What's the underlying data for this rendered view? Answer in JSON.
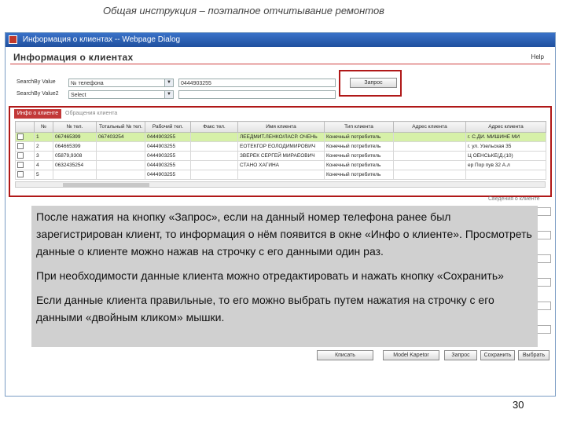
{
  "slide_title": "Общая инструкция – поэтапное отчитывание ремонтов",
  "window": {
    "title": "Информация о клиентах -- Webpage Dialog",
    "header": "Информация о клиентах",
    "help": "Help"
  },
  "search": {
    "row1_label": "SearchBy Value",
    "row1_select": "№ телефона",
    "row1_value": "0444903255",
    "row2_label": "SearchBy Value2",
    "row2_select": "Select",
    "query_button": "Запрос"
  },
  "tabs": [
    "Инфо о клиенте",
    "Обращения клиента"
  ],
  "grid": {
    "columns": [
      "",
      "№",
      "№ тел.",
      "Тотальный № тел.",
      "Рабочий тел.",
      "Факс тел.",
      "Имя клиента",
      "Тип клиента",
      "Адрес клиента",
      "Адрес клиента"
    ],
    "rows": [
      [
        "",
        "1",
        "067465399",
        "067403254",
        "0444903255",
        "",
        "ЛЕЕДМИТ.ЛЕНКО/ЛАСР. ОЧЕНЬ",
        "Конечный потребитель",
        "",
        "г. С.ДИ. МИШИНЕ МИ"
      ],
      [
        "",
        "2",
        "064665399",
        "",
        "0444903255",
        "",
        "ЕОТЕКГОР ЕОЛОДИМИРОВИЧ",
        "Конечный потребитель",
        "",
        "г. ул. Узельская 35"
      ],
      [
        "",
        "3",
        "05879,9308",
        "",
        "0444903255",
        "",
        "ЗВЕРЕК СЕРГЕЙ МИРАЕОВИЧ",
        "Конечный потребитель",
        "",
        "Ц ОЕНСЬКЕ(Д.(10)"
      ],
      [
        "",
        "4",
        "0632435254",
        "",
        "0444903255",
        "",
        "СТАНО ХАГИНА",
        "Конечный потребитель",
        "",
        "ер Пор пув 32 А.л"
      ],
      [
        "",
        "5",
        "",
        "",
        "0444903255",
        "",
        "",
        "Конечный потребитель",
        "",
        ""
      ]
    ]
  },
  "form_hint": "Сведения о клиенте",
  "overlay": {
    "p1": "После нажатия на кнопку «Запрос», если на данный номер телефона ранее был зарегистрирован клиент, то информация о нём появится в окне «Инфо о клиенте». Просмотреть данные о клиенте можно нажав на строчку с его данными один раз.",
    "p2": "При необходимости данные клиента можно отредактировать и нажать кнопку «Сохранить»",
    "p3": "Если данные клиента правильные, то его можно выбрать путем нажатия на строчку с его данными «двойным кликом» мышки."
  },
  "bottom_buttons": [
    "Кписать",
    "Model Kapetor",
    "Запрос",
    "Сохранить",
    "Выбрать"
  ],
  "page_number": "30",
  "colors": {
    "accent": "#b01818",
    "selected_row": "#d6f0a8",
    "titlebar": "#2a5fb4"
  }
}
